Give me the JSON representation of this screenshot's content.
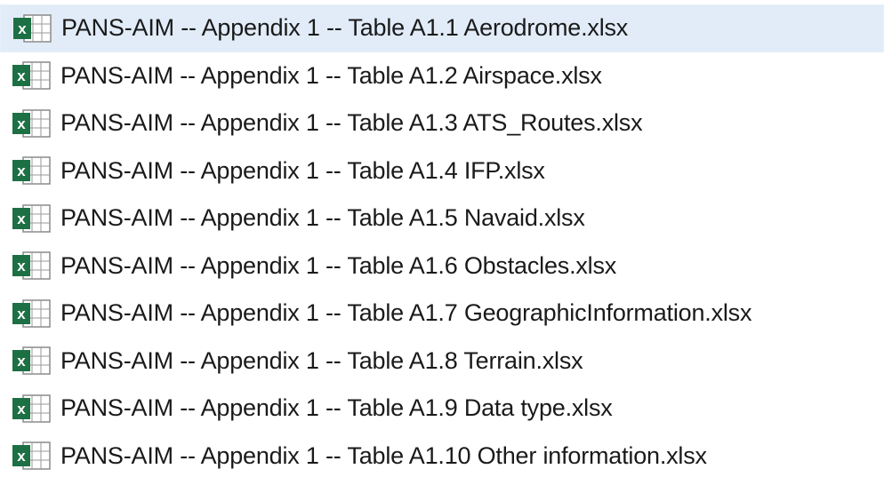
{
  "file_list": {
    "icon": "excel-file-icon",
    "colors": {
      "selected_row_bg": "#e5f0fb",
      "excel_green": "#1d7044",
      "text": "#1a1a1a"
    },
    "selected_index": 0,
    "items": [
      {
        "name": "PANS-AIM -- Appendix 1 -- Table A1.1 Aerodrome.xlsx"
      },
      {
        "name": "PANS-AIM -- Appendix 1 -- Table A1.2 Airspace.xlsx"
      },
      {
        "name": "PANS-AIM -- Appendix 1 -- Table A1.3 ATS_Routes.xlsx"
      },
      {
        "name": "PANS-AIM -- Appendix 1 -- Table A1.4 IFP.xlsx"
      },
      {
        "name": "PANS-AIM -- Appendix 1 -- Table A1.5 Navaid.xlsx"
      },
      {
        "name": "PANS-AIM -- Appendix 1 -- Table A1.6 Obstacles.xlsx"
      },
      {
        "name": "PANS-AIM -- Appendix 1 -- Table A1.7 GeographicInformation.xlsx"
      },
      {
        "name": "PANS-AIM -- Appendix 1 -- Table A1.8 Terrain.xlsx"
      },
      {
        "name": "PANS-AIM -- Appendix 1 -- Table A1.9 Data type.xlsx"
      },
      {
        "name": "PANS-AIM -- Appendix 1 -- Table A1.10 Other information.xlsx"
      }
    ]
  }
}
